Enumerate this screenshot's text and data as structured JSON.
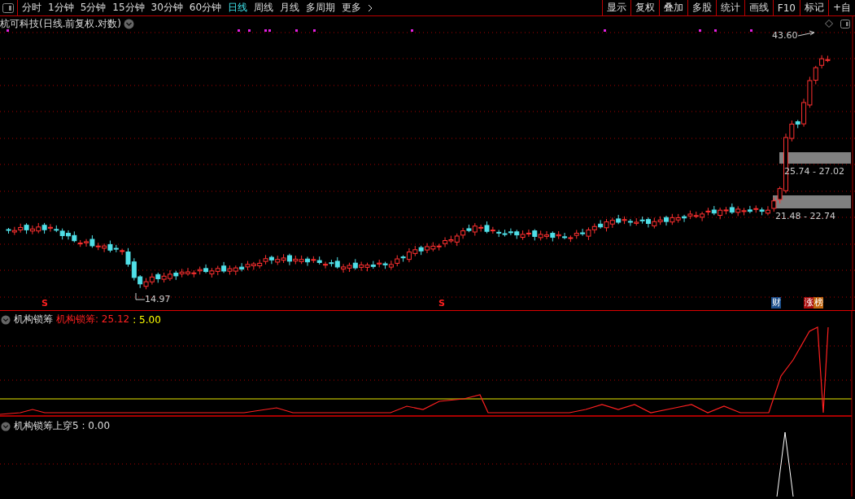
{
  "toolbar": {
    "periods": [
      {
        "label": "分时",
        "selected": false
      },
      {
        "label": "1分钟",
        "selected": false
      },
      {
        "label": "5分钟",
        "selected": false
      },
      {
        "label": "15分钟",
        "selected": false
      },
      {
        "label": "30分钟",
        "selected": false
      },
      {
        "label": "60分钟",
        "selected": false
      },
      {
        "label": "日线",
        "selected": true
      },
      {
        "label": "周线",
        "selected": false
      },
      {
        "label": "月线",
        "selected": false
      },
      {
        "label": "多周期",
        "selected": false
      }
    ],
    "more": "更多",
    "actions": [
      "显示",
      "复权",
      "叠加",
      "多股",
      "统计",
      "画线",
      "F10",
      "标记",
      "+自"
    ]
  },
  "chart": {
    "title": "杭可科技(日线.前复权.对数)",
    "high_label": "43.60",
    "low_label": "14.97",
    "zones": [
      "25.74 - 27.02",
      "21.48 - 22.74"
    ],
    "signals": [
      "S",
      "S"
    ],
    "badges": [
      {
        "text": "财",
        "color": "#1c4f8c"
      },
      {
        "text": "涨",
        "color": "#a80c0c"
      },
      {
        "text": "榜",
        "color": "#c0650e"
      }
    ]
  },
  "indicator": {
    "name": "机构锁筹",
    "value": "机构锁筹: 25.12",
    "threshold": ": 5.00"
  },
  "crossover": {
    "label": "机构锁筹上穿5 : 0.00"
  }
}
